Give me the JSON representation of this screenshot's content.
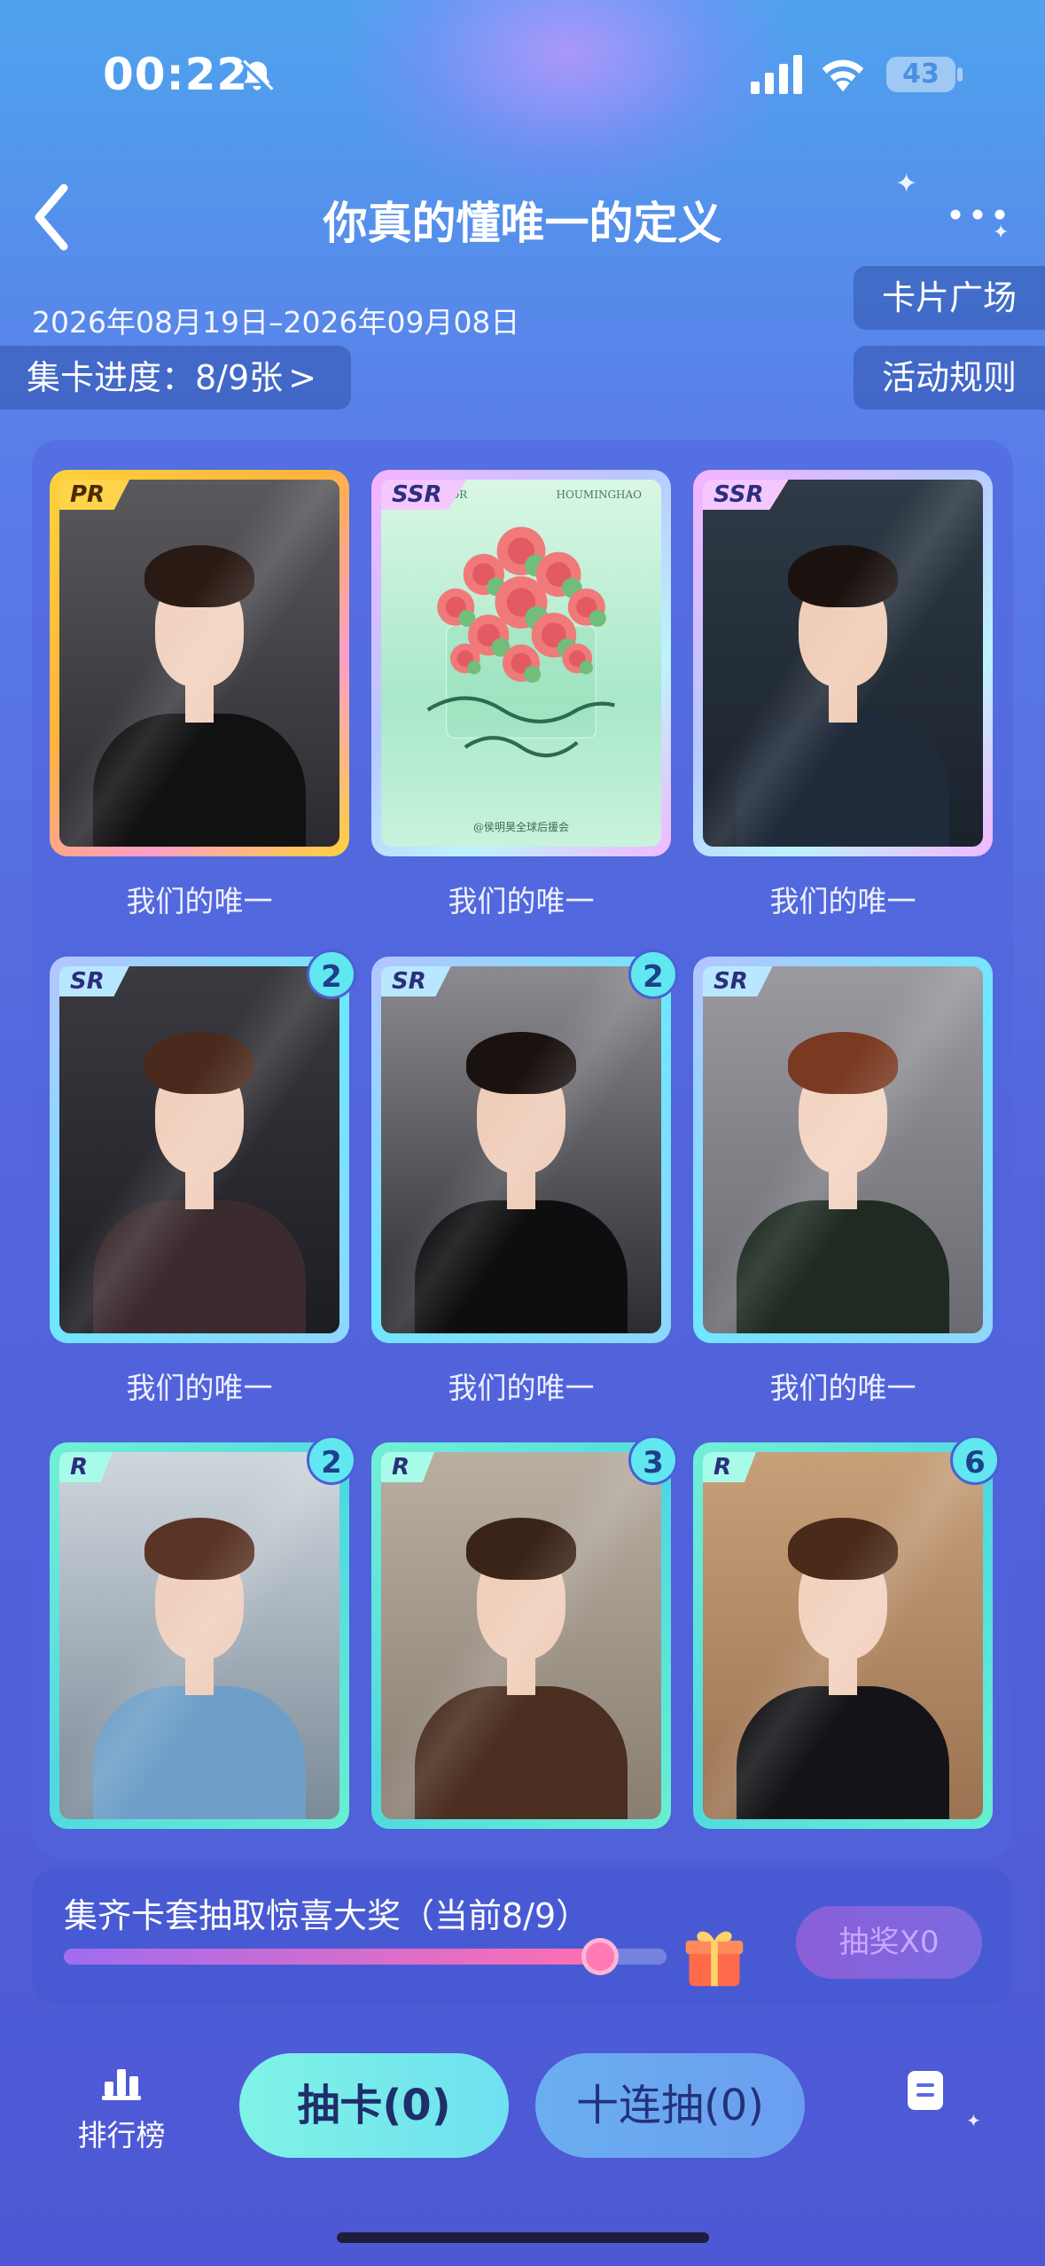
{
  "status_bar": {
    "time": "00:22",
    "battery": "43"
  },
  "header": {
    "title": "你真的懂唯一的定义",
    "date_range": "2026年08月19日–2026年09月08日"
  },
  "progress": {
    "label": "集卡进度：8/9张",
    "collected": 8,
    "total": 9
  },
  "side_buttons": {
    "plaza": "卡片广场",
    "rules": "活动规则"
  },
  "cards": [
    {
      "rarity": "PR",
      "name": "我们的唯一",
      "count": "",
      "theme": "photo"
    },
    {
      "rarity": "SSR",
      "name": "我们的唯一",
      "count": "",
      "theme": "roses",
      "poster": {
        "top_left": "FOR",
        "top_right": "HOUMINGHAO",
        "footer": "@侯明昊全球后援会"
      }
    },
    {
      "rarity": "SSR",
      "name": "我们的唯一",
      "count": "",
      "theme": "photo"
    },
    {
      "rarity": "SR",
      "name": "我们的唯一",
      "count": "2",
      "theme": "photo"
    },
    {
      "rarity": "SR",
      "name": "我们的唯一",
      "count": "2",
      "theme": "photo"
    },
    {
      "rarity": "SR",
      "name": "我们的唯一",
      "count": "",
      "theme": "photo"
    },
    {
      "rarity": "R",
      "name": "",
      "count": "2",
      "theme": "photo"
    },
    {
      "rarity": "R",
      "name": "",
      "count": "3",
      "theme": "photo"
    },
    {
      "rarity": "R",
      "name": "",
      "count": "6",
      "theme": "photo"
    }
  ],
  "lottery": {
    "text": "集齐卡套抽取惊喜大奖（当前8/9）",
    "progress_fraction": 0.889,
    "button": "抽奖X0"
  },
  "footer": {
    "ranking": "排行榜",
    "draw_one": "抽卡(0)",
    "draw_ten": "十连抽(0)"
  },
  "icons": [
    "back-chevron-icon",
    "more-icon",
    "bell-slash-icon",
    "signal-icon",
    "wifi-icon",
    "gift-icon",
    "ranking-icon",
    "record-icon"
  ]
}
